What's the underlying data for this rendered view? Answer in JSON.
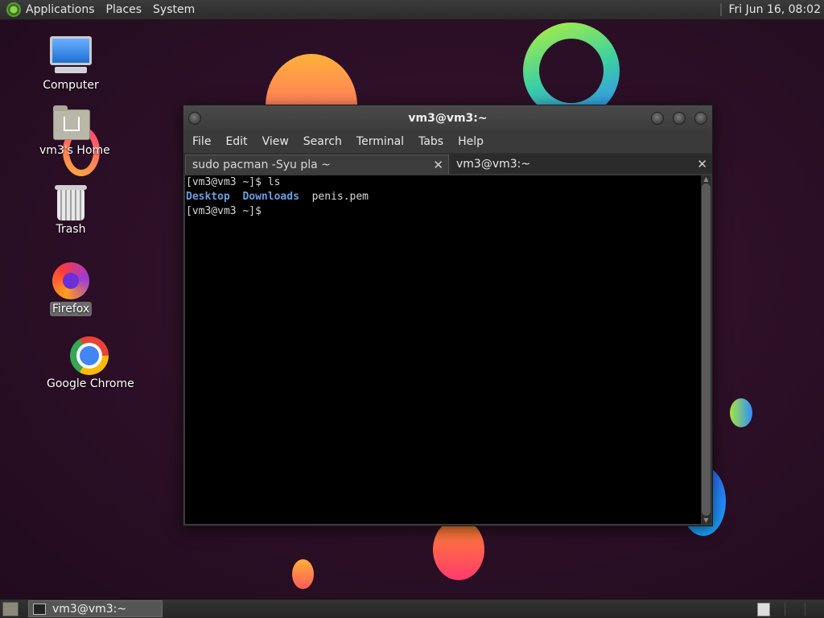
{
  "top_panel": {
    "menus": [
      "Applications",
      "Places",
      "System"
    ],
    "clock": "Fri Jun 16, 08:02"
  },
  "desktop_icons": [
    {
      "label": "Computer",
      "icon": "computer-icon"
    },
    {
      "label": "vm3's Home",
      "icon": "home-folder-icon"
    },
    {
      "label": "Trash",
      "icon": "trash-icon"
    },
    {
      "label": "Firefox",
      "icon": "firefox-icon",
      "selected": true
    },
    {
      "label": "Google Chrome",
      "icon": "chrome-icon"
    }
  ],
  "terminal": {
    "title": "vm3@vm3:~",
    "menu": [
      "File",
      "Edit",
      "View",
      "Search",
      "Terminal",
      "Tabs",
      "Help"
    ],
    "tabs": [
      {
        "label": "sudo pacman -Syu pla ~",
        "active": false
      },
      {
        "label": "vm3@vm3:~",
        "active": true
      }
    ],
    "lines": {
      "line1": "[vm3@vm3 ~]$ ls",
      "dir1": "Desktop",
      "dir2": "Downloads",
      "file1": "penis.pem",
      "line3": "[vm3@vm3 ~]$"
    },
    "colors": {
      "directory": "#6a9fe0",
      "background": "#000000"
    }
  },
  "bottom_panel": {
    "task": "vm3@vm3:~"
  }
}
